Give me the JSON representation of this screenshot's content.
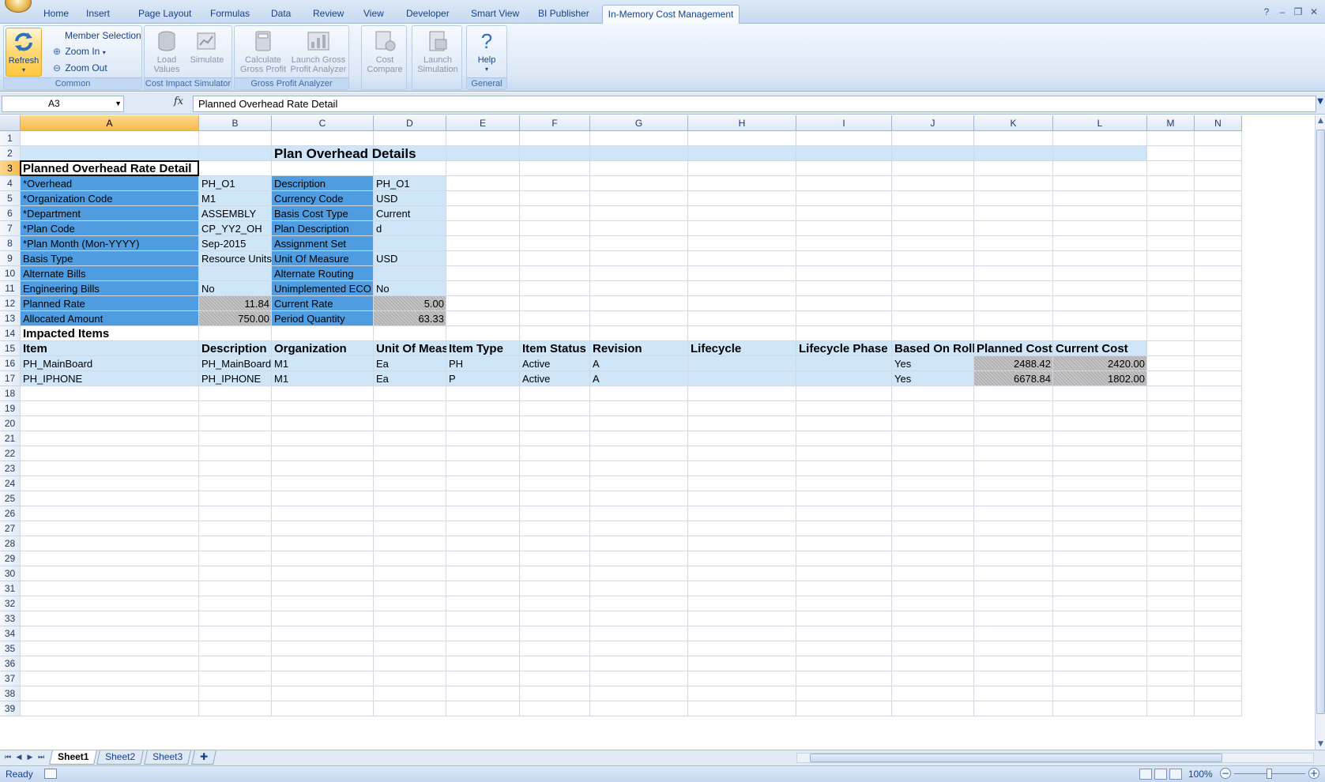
{
  "ribbon_tabs": [
    {
      "label": "Home"
    },
    {
      "label": "Insert"
    },
    {
      "label": "Page Layout"
    },
    {
      "label": "Formulas"
    },
    {
      "label": "Data"
    },
    {
      "label": "Review"
    },
    {
      "label": "View"
    },
    {
      "label": "Developer"
    },
    {
      "label": "Smart View"
    },
    {
      "label": "BI Publisher"
    },
    {
      "label": "In-Memory Cost Management",
      "active": true
    }
  ],
  "window_controls": {
    "help": "?",
    "minimize": "–",
    "restore": "❐",
    "close": "✕"
  },
  "ribbon": {
    "common": {
      "label": "Common",
      "refresh": "Refresh",
      "member_selection": "Member Selection",
      "zoom_in": "Zoom In",
      "zoom_out": "Zoom Out"
    },
    "cost_impact": {
      "label": "Cost Impact Simulator",
      "load_values_1": "Load",
      "load_values_2": "Values",
      "simulate": "Simulate"
    },
    "gross_profit": {
      "label": "Gross Profit Analyzer",
      "calculate_1": "Calculate",
      "calculate_2": "Gross Profit",
      "launch_1": "Launch Gross",
      "launch_2": "Profit Analyzer"
    },
    "cost_compare": {
      "label_1": "Cost",
      "label_2": "Compare"
    },
    "simulation": {
      "label_1": "Launch",
      "label_2": "Simulation"
    },
    "general": {
      "label": "General",
      "help": "Help"
    }
  },
  "formula_bar": {
    "name_box": "A3",
    "fx": "fx",
    "formula": "Planned Overhead Rate Detail"
  },
  "columns": [
    "A",
    "B",
    "C",
    "D",
    "E",
    "F",
    "G",
    "H",
    "I",
    "J",
    "K",
    "L",
    "M",
    "N"
  ],
  "rows": [
    "1",
    "2",
    "3",
    "4",
    "5",
    "6",
    "7",
    "8",
    "9",
    "10",
    "11",
    "12",
    "13",
    "14",
    "15",
    "16",
    "17",
    "18",
    "19",
    "20",
    "21",
    "22",
    "23",
    "24",
    "25",
    "26",
    "27",
    "28",
    "29",
    "30",
    "31",
    "32",
    "33",
    "34",
    "35",
    "36",
    "37",
    "38",
    "39"
  ],
  "sheet": {
    "title": "Plan Overhead Details",
    "section_title": "Planned Overhead Rate Detail",
    "fields": [
      {
        "label": "*Overhead",
        "value": "PH_O1",
        "label2": "Description",
        "value2": "PH_O1"
      },
      {
        "label": "*Organization Code",
        "value": "M1",
        "label2": "Currency Code",
        "value2": "USD"
      },
      {
        "label": "*Department",
        "value": "ASSEMBLY",
        "label2": "Basis Cost Type",
        "value2": "Current"
      },
      {
        "label": "*Plan Code",
        "value": "CP_YY2_OH",
        "label2": "Plan Description",
        "value2": "d"
      },
      {
        "label": "*Plan Month (Mon-YYYY)",
        "value": "Sep-2015",
        "label2": "Assignment Set",
        "value2": ""
      },
      {
        "label": "Basis Type",
        "value": "Resource Units",
        "label2": "Unit Of Measure",
        "value2": "USD"
      },
      {
        "label": "Alternate Bills",
        "value": "",
        "label2": "Alternate Routing",
        "value2": ""
      },
      {
        "label": "Engineering Bills",
        "value": "No",
        "label2": "Unimplemented ECO",
        "value2": "No"
      },
      {
        "label": "Planned Rate",
        "value": "11.84",
        "label2": "Current Rate",
        "value2": "5.00"
      },
      {
        "label": "Allocated Amount",
        "value": "750.00",
        "label2": "Period Quantity",
        "value2": "63.33"
      }
    ],
    "impacted_title": "Impacted Items",
    "impacted_headers": [
      "Item",
      "Description",
      "Organization",
      "Unit Of Meas",
      "Item Type",
      "Item Status",
      "Revision",
      "Lifecycle",
      "Lifecycle Phase",
      "Based On Roll",
      "Planned Cost",
      "Current Cost"
    ],
    "impacted_rows": [
      [
        "PH_MainBoard",
        "PH_MainBoard",
        "M1",
        "Ea",
        "PH",
        "Active",
        "A",
        "",
        "",
        "Yes",
        "2488.42",
        "2420.00"
      ],
      [
        "PH_IPHONE",
        "PH_IPHONE",
        "M1",
        "Ea",
        "P",
        "Active",
        "A",
        "",
        "",
        "Yes",
        "6678.84",
        "1802.00"
      ]
    ]
  },
  "sheet_tabs": [
    "Sheet1",
    "Sheet2",
    "Sheet3"
  ],
  "status": {
    "text": "Ready",
    "zoom": "100%"
  }
}
